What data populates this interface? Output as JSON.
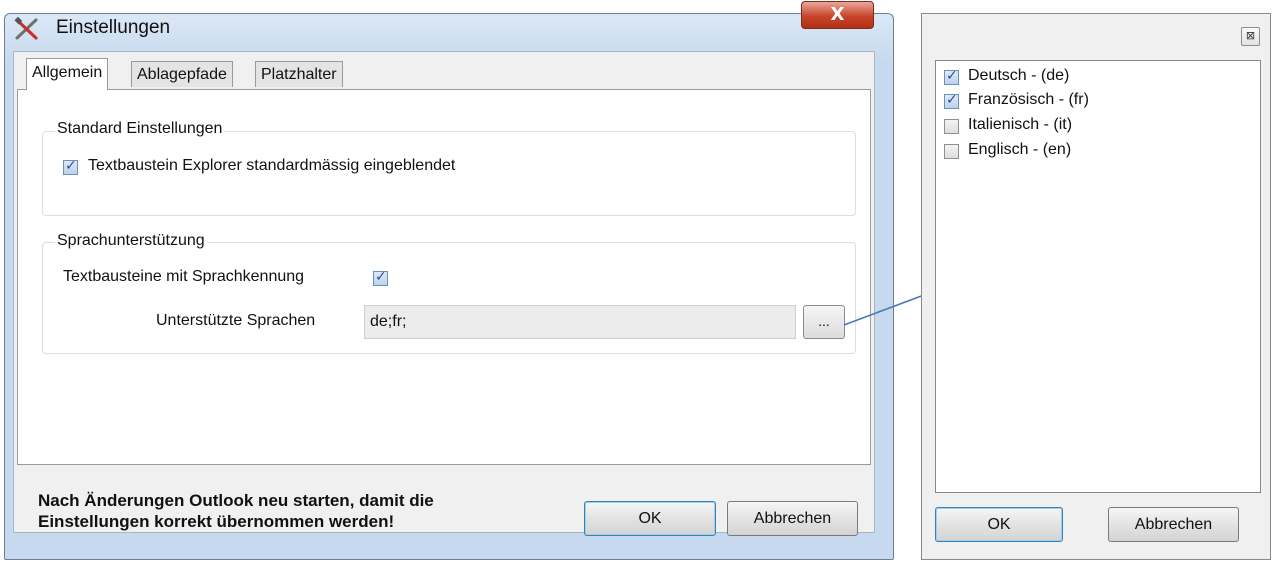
{
  "main_dialog": {
    "title": "Einstellungen",
    "close_glyph": "X",
    "tabs": [
      {
        "label": "Allgemein",
        "active": true
      },
      {
        "label": "Ablagepfade",
        "active": false
      },
      {
        "label": "Platzhalter",
        "active": false
      }
    ],
    "standard_group": {
      "legend": "Standard Einstellungen",
      "explorer_checkbox": {
        "label": "Textbaustein Explorer standardmässig eingeblendet",
        "checked": true
      }
    },
    "language_group": {
      "legend": "Sprachunterstützung",
      "language_id_checkbox": {
        "label": "Textbausteine mit Sprachkennung",
        "checked": true
      },
      "supported_label": "Unterstützte Sprachen",
      "supported_value": "de;fr;",
      "browse_button": "..."
    },
    "footer_line1": "Nach Änderungen Outlook neu starten, damit die",
    "footer_line2": "Einstellungen korrekt übernommen werden!",
    "ok_button": "OK",
    "cancel_button": "Abbrechen"
  },
  "language_dialog": {
    "close_glyph": "⊠",
    "languages": [
      {
        "label": "Deutsch - (de)",
        "checked": true
      },
      {
        "label": "Französisch - (fr)",
        "checked": true
      },
      {
        "label": "Italienisch - (it)",
        "checked": false
      },
      {
        "label": "Englisch - (en)",
        "checked": false
      }
    ],
    "ok_button": "OK",
    "cancel_button": "Abbrechen"
  },
  "icons": {
    "app_icon": "tools-icon",
    "check_glyph": "✓",
    "connector": "arrow-icon"
  },
  "colors": {
    "title_bar": "#c7d9ee",
    "close_button": "#c7442b",
    "connector_arrow": "#4a7ab8",
    "check_mark": "#2b4fa0"
  }
}
